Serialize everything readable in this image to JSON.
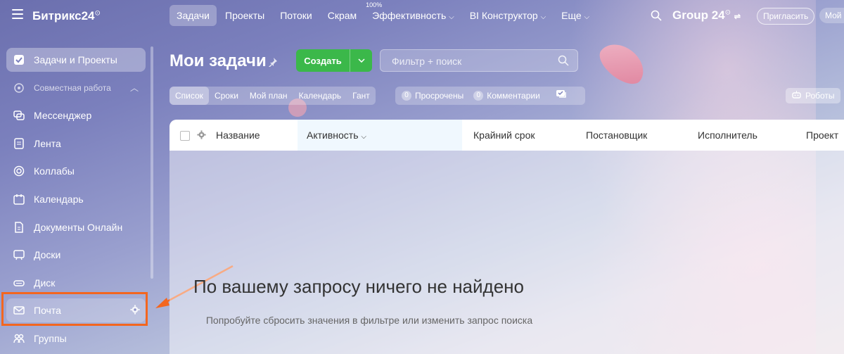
{
  "header": {
    "brand": "Битрикс24",
    "brand_sup": "⊙",
    "nav": [
      {
        "label": "Задачи",
        "active": true
      },
      {
        "label": "Проекты"
      },
      {
        "label": "Потоки"
      },
      {
        "label": "Скрам"
      },
      {
        "label": "Эффективность",
        "badge": "100%"
      },
      {
        "label": "BI Конструктор"
      },
      {
        "label": "Еще"
      }
    ],
    "group": "Group 24",
    "invite": "Пригласить",
    "my": "Мой"
  },
  "sidebar": {
    "items": [
      {
        "label": "Задачи и Проекты",
        "icon": "checkbox-icon",
        "active": true
      },
      {
        "label": "Совместная работа",
        "icon": "collab-group-icon"
      },
      {
        "label": "Мессенджер",
        "icon": "messenger-icon"
      },
      {
        "label": "Лента",
        "icon": "feed-icon"
      },
      {
        "label": "Коллабы",
        "icon": "collabs-icon"
      },
      {
        "label": "Календарь",
        "icon": "calendar-icon"
      },
      {
        "label": "Документы Онлайн",
        "icon": "document-icon"
      },
      {
        "label": "Доски",
        "icon": "boards-icon"
      },
      {
        "label": "Диск",
        "icon": "disk-icon"
      },
      {
        "label": "Почта",
        "icon": "mail-icon"
      },
      {
        "label": "Группы",
        "icon": "groups-icon"
      }
    ]
  },
  "main": {
    "title": "Мои задачи",
    "create": "Создать",
    "filter_placeholder": "Фильтр + поиск",
    "views": [
      "Список",
      "Сроки",
      "Мой план",
      "Календарь",
      "Гант"
    ],
    "counters": [
      {
        "n": "0",
        "label": "Просрочены"
      },
      {
        "n": "0",
        "label": "Комментарии"
      }
    ],
    "robots": "Роботы",
    "columns": [
      "Название",
      "Активность",
      "Крайний срок",
      "Постановщик",
      "Исполнитель",
      "Проект"
    ],
    "empty_title": "По вашему запросу ничего не найдено",
    "empty_hint": "Попробуйте сбросить значения в фильтре или изменить запрос поиска"
  },
  "colors": {
    "accent_green": "#3bb84a",
    "highlight": "#f3661f"
  }
}
